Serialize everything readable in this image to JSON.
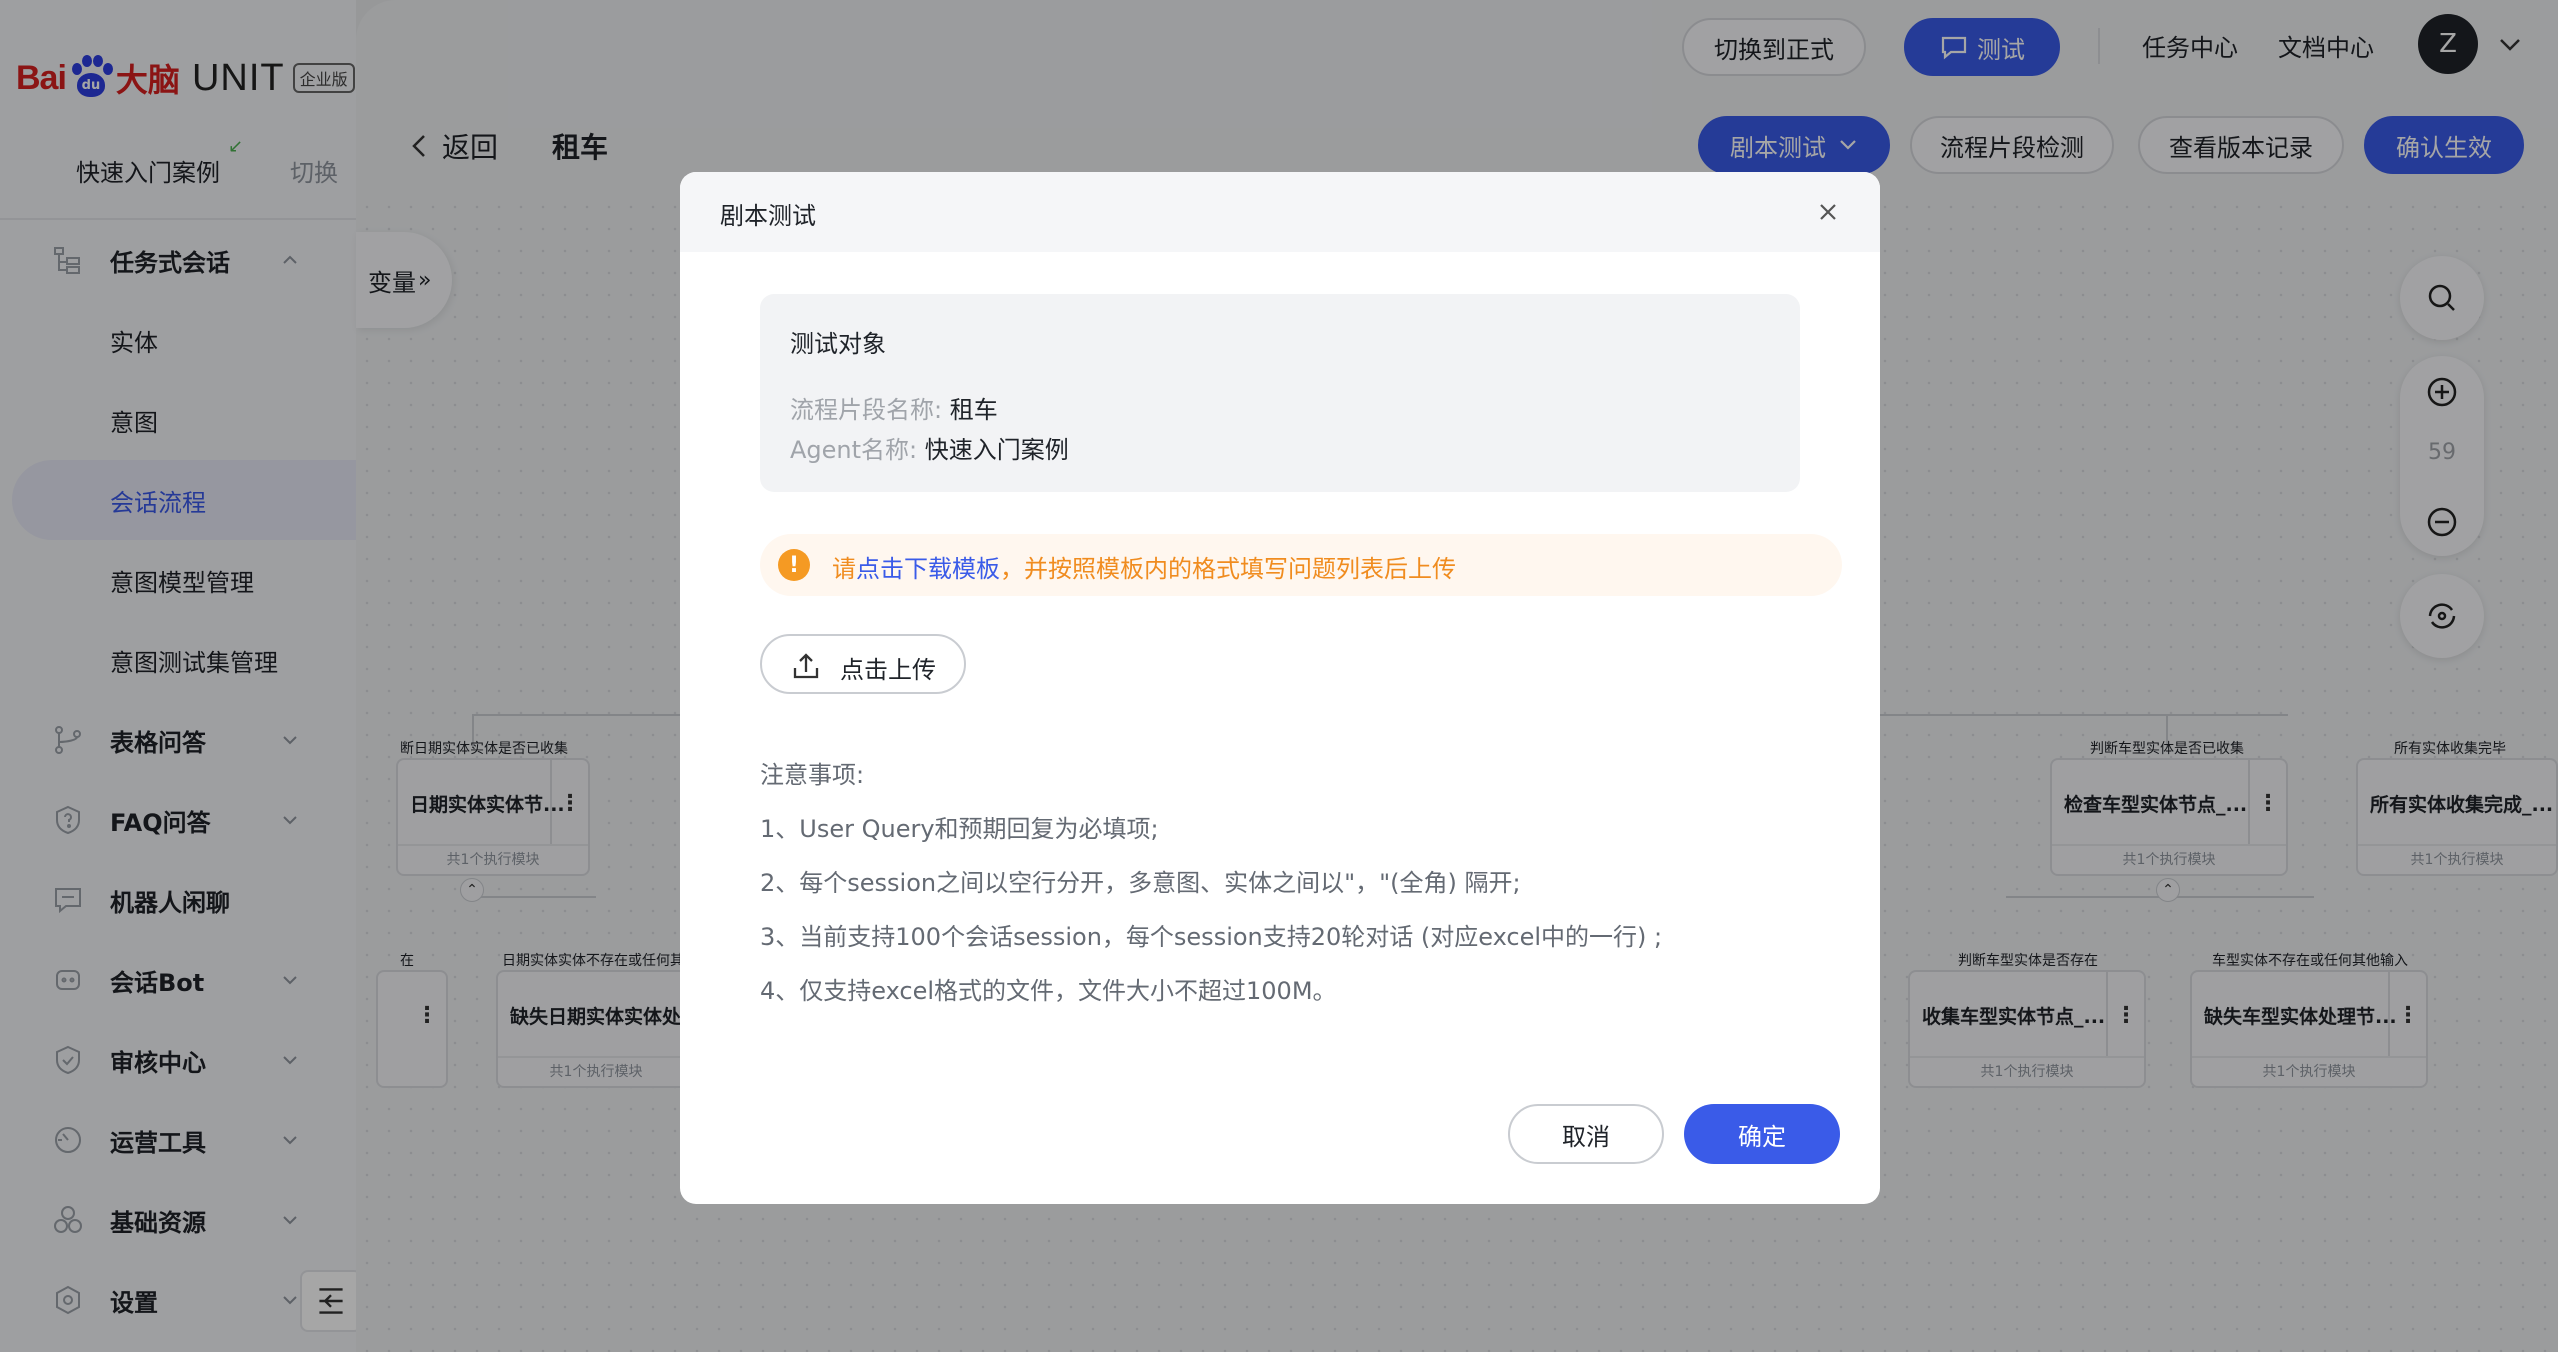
{
  "logo": {
    "bai": "Bai",
    "du": "du",
    "dn": "大脑",
    "unit": "UNIT",
    "badge": "企业版"
  },
  "agent": {
    "name": "快速入门案例",
    "switch_label": "切换"
  },
  "nav": {
    "task": "任务式会话",
    "sub": {
      "entity": "实体",
      "intent": "意图",
      "flow": "会话流程",
      "model": "意图模型管理",
      "testset": "意图测试集管理"
    },
    "table_qa": "表格问答",
    "faq": "FAQ问答",
    "chat": "机器人闲聊",
    "bot": "会话Bot",
    "review": "审核中心",
    "ops": "运营工具",
    "resource": "基础资源",
    "settings": "设置"
  },
  "topbar": {
    "switch_formal": "切换到正式",
    "test": "测试",
    "task_center": "任务中心",
    "doc_center": "文档中心",
    "avatar": "Z"
  },
  "subbar": {
    "back": "返回",
    "title": "租车",
    "script_test": "剧本测试",
    "segment_check": "流程片段检测",
    "version_log": "查看版本记录",
    "confirm": "确认生效"
  },
  "canvas": {
    "variable_tab": "变量",
    "zoom": "59",
    "nodes": {
      "n1_label": "断日期实体实体是否已收集",
      "n1_title": "日期实体实体节...",
      "n2_label": "判断车型实体是否已收集",
      "n2_title": "检查车型实体节点_...",
      "n3_label": "所有实体收集完毕",
      "n3_title": "所有实体收集完成_...",
      "n4_label": "在",
      "n5_label": "日期实体实体不存在或任何其",
      "n5_title": "缺失日期实体实体处",
      "n6_label": "判断车型实体是否存在",
      "n6_title": "收集车型实体节点_...",
      "n7_label": "车型实体不存在或任何其他输入",
      "n7_title": "缺失车型实体处理节...",
      "foot": "共1个执行模块"
    }
  },
  "modal": {
    "title": "剧本测试",
    "target_title": "测试对象",
    "segment_key": "流程片段名称:",
    "segment_val": "租车",
    "agent_key": "Agent名称:",
    "agent_val": "快速入门案例",
    "warn_pre": "请",
    "warn_link": "点击下载模板",
    "warn_post": "，并按照模板内的格式填写问题列表后上传",
    "upload": "点击上传",
    "notes": [
      "注意事项:",
      "1、User Query和预期回复为必填项;",
      "2、每个session之间以空行分开，多意图、实体之间以\"，\"(全角) 隔开;",
      "3、当前支持100个会话session，每个session支持20轮对话 (对应excel中的一行) ;",
      "4、仅支持excel格式的文件，文件大小不超过100M。"
    ],
    "cancel": "取消",
    "ok": "确定"
  },
  "colors": {
    "primary": "#3a5be8",
    "warning": "#f08c1f",
    "brand_red": "#d6201f"
  }
}
